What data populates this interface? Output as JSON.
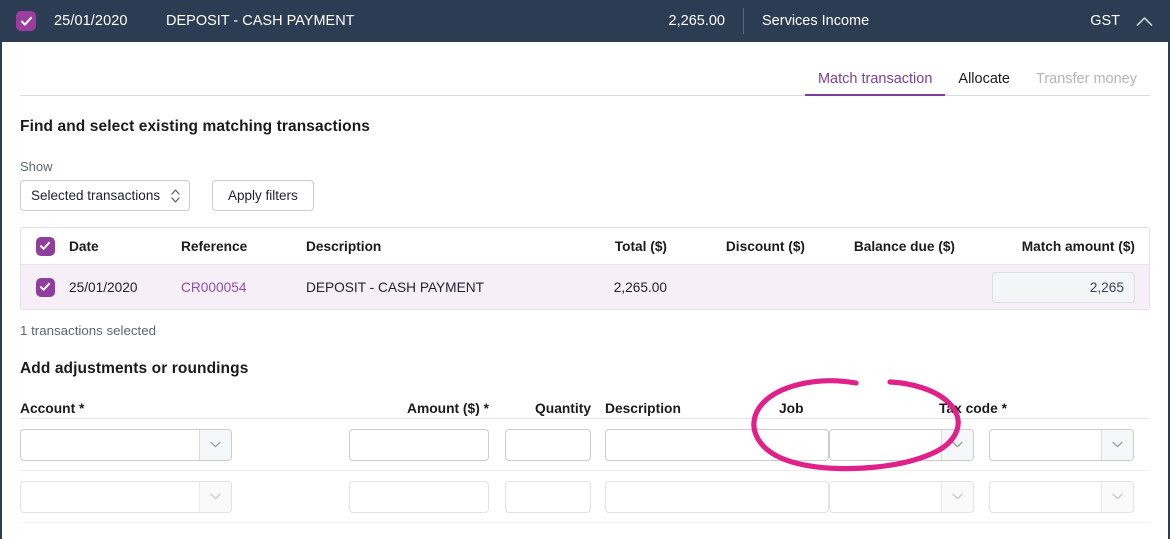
{
  "header": {
    "checkbox_icon": "check-icon",
    "date": "25/01/2020",
    "description": "DEPOSIT - CASH PAYMENT",
    "total": "2,265.00",
    "account": "Services Income",
    "tax_code": "GST",
    "collapse_icon": "chevron-up-icon"
  },
  "tabs": [
    {
      "label": "Match transaction",
      "state": "active"
    },
    {
      "label": "Allocate",
      "state": "default"
    },
    {
      "label": "Transfer money",
      "state": "disabled"
    }
  ],
  "match_section": {
    "title": "Find and select existing matching transactions",
    "show_label": "Show",
    "show_value": "Selected transactions",
    "apply_filters_label": "Apply filters",
    "columns": [
      "Date",
      "Reference",
      "Description",
      "Total ($)",
      "Discount ($)",
      "Balance due ($)",
      "Match amount ($)"
    ],
    "rows": [
      {
        "selected": true,
        "date": "25/01/2020",
        "reference": "CR000054",
        "description": "DEPOSIT - CASH PAYMENT",
        "total": "2,265.00",
        "discount": "",
        "balance_due": "",
        "match_amount": "2,265"
      }
    ],
    "selected_count_text": "1 transactions selected"
  },
  "adjustments_section": {
    "title": "Add adjustments or roundings",
    "columns": [
      "Account *",
      "Amount ($) *",
      "Quantity",
      "Description",
      "Job",
      "Tax code *"
    ],
    "rows": [
      {
        "account": "",
        "amount": "",
        "quantity": "",
        "description": "",
        "job": "",
        "tax_code": "",
        "delete_icon": "remove-circle-icon"
      },
      {
        "account": "",
        "amount": "",
        "quantity": "",
        "description": "",
        "job": "",
        "tax_code": "",
        "delete_icon": "remove-circle-icon"
      }
    ]
  },
  "annotation": {
    "shape": "hand-drawn-ellipse",
    "target": "Job",
    "color": "#e0218a"
  },
  "colors": {
    "header_bg": "#2c3c52",
    "accent_purple": "#7b3f98",
    "checkbox_purple": "#8e3f9e",
    "link_purple": "#8e52a8",
    "selected_row_bg": "#f6eff8",
    "annotation_pink": "#e0218a"
  }
}
